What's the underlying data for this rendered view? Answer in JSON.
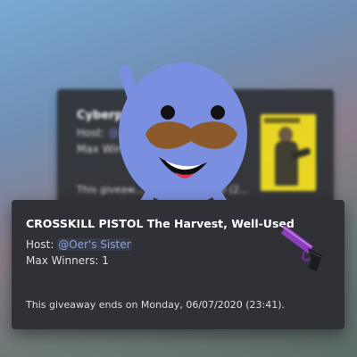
{
  "background_embed": {
    "title": "Cyberpu",
    "host_label": "Host: ",
    "host_mention": "@",
    "max_winners": "Max Win",
    "ends_text": "This giveaw... ends on ... 2020 (2..."
  },
  "mascot": {
    "name": "blurple mascot with mustache",
    "icon": "mascot-icon",
    "color": "#7289da"
  },
  "embed": {
    "title": "CROSSKILL PISTOL The Harvest, Well-Used",
    "host_label": "Host: ",
    "host_mention": "@Oer's Sister",
    "max_winners": "Max Winners: 1",
    "ends_text": "This giveaway ends on Monday, 06/07/2020 (23:41).",
    "thumbnail_icon": "pistol-icon"
  },
  "colors": {
    "embed_bg": "#2f3136",
    "mention": "#8ea1e1",
    "text": "#dcddde",
    "title": "#ffffff",
    "thumb_bg": "#f2de1b"
  }
}
